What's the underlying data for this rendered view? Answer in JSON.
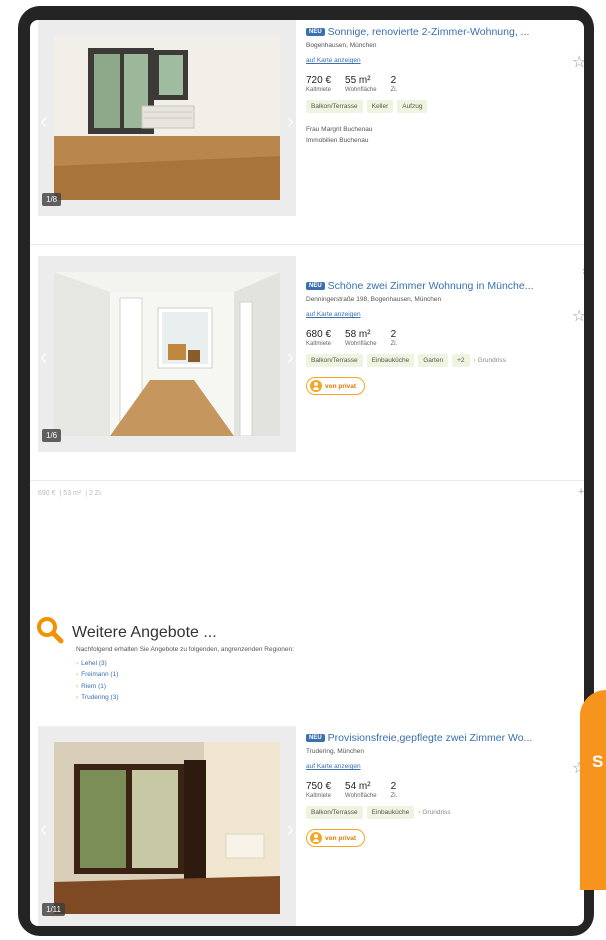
{
  "listings": [
    {
      "badge": "NEU",
      "title": "Sonnige, renovierte 2-Zimmer-Wohnung, ...",
      "address": "Bogenhausen, München",
      "map_link": "auf Karte anzeigen",
      "price": "720 €",
      "price_label": "Kaltmiete",
      "area": "55 m²",
      "area_label": "Wohnfläche",
      "rooms": "2",
      "rooms_label": "Zi.",
      "tags": [
        "Balkon/Terrasse",
        "Keller",
        "Aufzug"
      ],
      "contact_name": "Frau Margrit Buchenau",
      "contact_company": "Immobilien Buchenau",
      "counter": "1/8"
    },
    {
      "badge": "NEU",
      "title": "Schöne zwei Zimmer Wohnung in Münche...",
      "address": "Denningerstraße 198, Bogenhausen, München",
      "map_link": "auf Karte anzeigen",
      "price": "680 €",
      "price_label": "Kaltmiete",
      "area": "58 m²",
      "area_label": "Wohnfläche",
      "rooms": "2",
      "rooms_label": "Zi.",
      "tags": [
        "Balkon/Terrasse",
        "Einbauküche",
        "Garten"
      ],
      "tags_more": "+2",
      "grundriss": "Grundriss",
      "private_badge": "von privat",
      "counter": "1/6",
      "close_glyph": "×"
    },
    {
      "badge": "NEU",
      "title": "Provisionsfreie,gepflegte zwei Zimmer Wo...",
      "address": "Trudering, München",
      "map_link": "auf Karte anzeigen",
      "price": "750 €",
      "price_label": "Kaltmiete",
      "area": "54 m²",
      "area_label": "Wohnfläche",
      "rooms": "2",
      "rooms_label": "Zi.",
      "tags": [
        "Balkon/Terrasse",
        "Einbauküche"
      ],
      "grundriss": "Grundriss",
      "private_badge": "von privat",
      "counter": "1/11"
    }
  ],
  "collapsed_listing": {
    "price": "690 €",
    "area": "53 m²",
    "rooms": "2 Zi.",
    "expand_glyph": "+"
  },
  "more_offers": {
    "title": "Weitere Angebote ...",
    "description": "Nachfolgend erhalten Sie Angebote zu folgenden, angrenzenden Regionen:",
    "regions": [
      "Lehel (3)",
      "Freimann (1)",
      "Riem (1)",
      "Trudering (3)"
    ]
  },
  "overlay_letter": "S",
  "icons": {
    "star": "star-outline-icon",
    "search": "search-icon",
    "chevron": "chevron-right-icon"
  },
  "colors": {
    "link": "#3a6fb0",
    "accent": "#f5a623",
    "overlay": "#f7941d",
    "tag_bg": "#eef4df"
  }
}
